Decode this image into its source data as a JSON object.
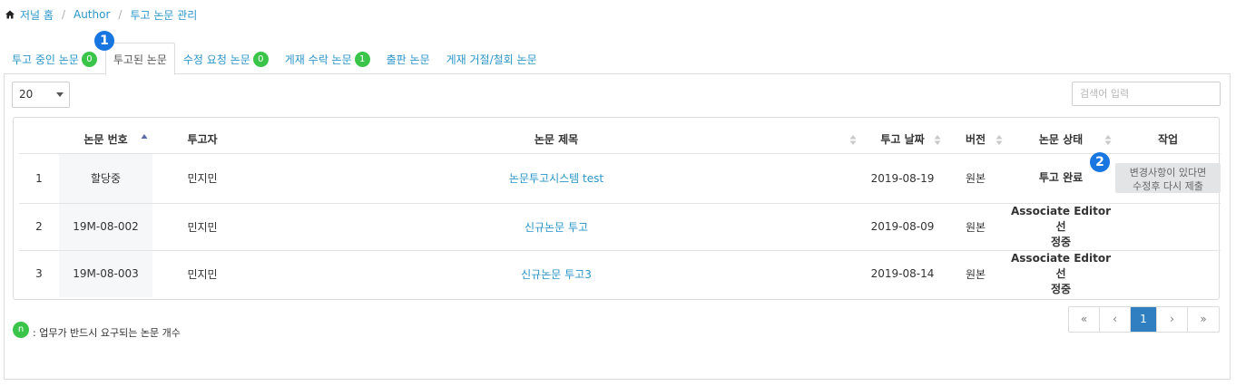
{
  "breadcrumb": {
    "home_icon": "home-icon",
    "items": [
      "저널 홈",
      "Author",
      "투고 논문 관리"
    ],
    "separator": "/"
  },
  "tabs": [
    {
      "label": "투고 중인 논문",
      "badge": "0",
      "active": false
    },
    {
      "label": "투고된 논문",
      "badge": null,
      "active": true
    },
    {
      "label": "수정 요청 논문",
      "badge": "0",
      "active": false
    },
    {
      "label": "게재 수락 논문",
      "badge": "1",
      "active": false
    },
    {
      "label": "출판 논문",
      "badge": null,
      "active": false
    },
    {
      "label": "게재 거절/철회 논문",
      "badge": null,
      "active": false
    }
  ],
  "markers": {
    "m1": "1",
    "m2": "2"
  },
  "controls": {
    "page_size": "20",
    "search_placeholder": "검색어 입력"
  },
  "table": {
    "headers": {
      "no": "",
      "paper_number": "논문 번호",
      "author": "투고자",
      "title": "논문 제목",
      "submit_date": "투고 날짜",
      "version": "버전",
      "status": "논문 상태",
      "action": "작업"
    },
    "rows": [
      {
        "no": "1",
        "paper_number": "할당중",
        "author": "민지민",
        "title": "논문투고시스템 test",
        "submit_date": "2019-08-19",
        "version": "원본",
        "status": "투고 완료",
        "action_line1": "변경사항이 있다면",
        "action_line2": "수정후 다시 제출"
      },
      {
        "no": "2",
        "paper_number": "19M-08-002",
        "author": "민지민",
        "title": "신규논문 투고",
        "submit_date": "2019-08-09",
        "version": "원본",
        "status_line1": "Associate Editor 선",
        "status_line2": "정중"
      },
      {
        "no": "3",
        "paper_number": "19M-08-003",
        "author": "민지민",
        "title": "신규논문 투고3",
        "submit_date": "2019-08-14",
        "version": "원본",
        "status_line1": "Associate Editor 선",
        "status_line2": "정중"
      }
    ]
  },
  "legend": {
    "badge": "n",
    "text": ": 업무가 반드시 요구되는 논문 개수"
  },
  "pagination": {
    "first": "«",
    "prev": "‹",
    "current": "1",
    "next": "›",
    "last": "»"
  },
  "colors": {
    "link": "#2a95c9",
    "badge": "#3ac54a",
    "marker": "#1876e0",
    "pager_active": "#2f7fc1"
  }
}
